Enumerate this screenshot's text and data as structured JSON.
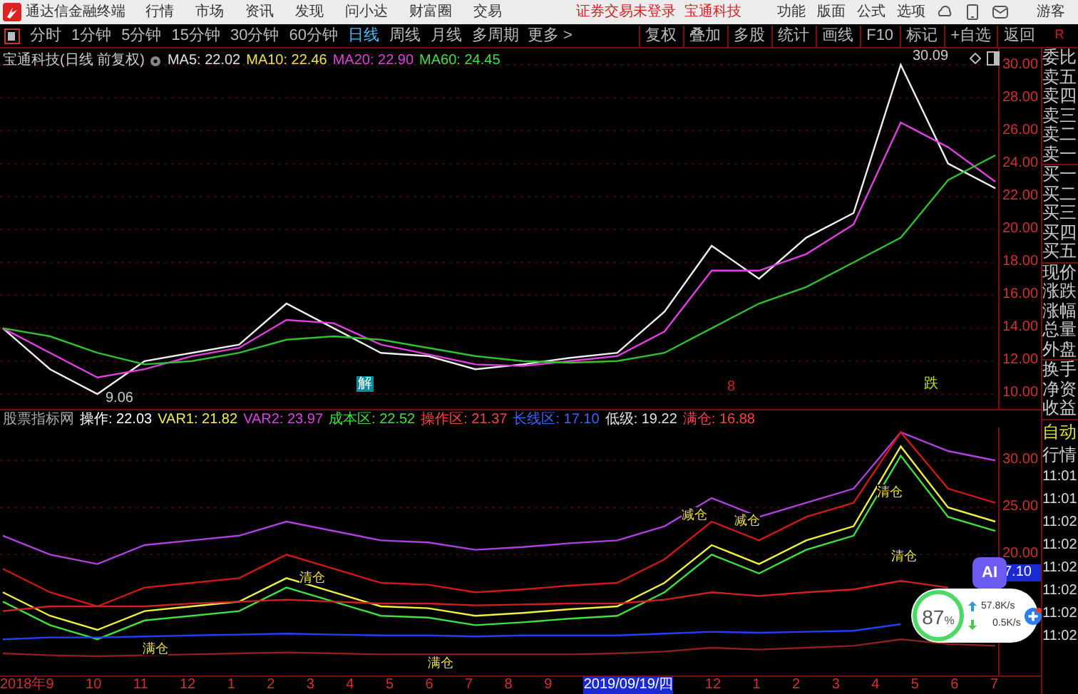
{
  "app": {
    "title": "通达信金融终端",
    "menu": [
      "行情",
      "市场",
      "资讯",
      "发现",
      "问小达",
      "财富圈",
      "交易"
    ],
    "login_status": "证券交易未登录",
    "stock_link": "宝通科技",
    "tools": [
      "功能",
      "版面",
      "公式",
      "选项"
    ],
    "user": "游客"
  },
  "toolbar": {
    "periods": [
      {
        "label": "分时",
        "selected": false
      },
      {
        "label": "1分钟",
        "selected": false
      },
      {
        "label": "5分钟",
        "selected": false
      },
      {
        "label": "15分钟",
        "selected": false
      },
      {
        "label": "30分钟",
        "selected": false
      },
      {
        "label": "60分钟",
        "selected": false
      },
      {
        "label": "日线",
        "selected": true
      },
      {
        "label": "周线",
        "selected": false
      },
      {
        "label": "月线",
        "selected": false
      },
      {
        "label": "多周期",
        "selected": false
      }
    ],
    "more": "更多 >",
    "actions": [
      "复权",
      "叠加",
      "多股",
      "统计",
      "画线",
      "F10",
      "标记",
      "+自选",
      "返回"
    ],
    "corner": "R"
  },
  "main_chart": {
    "title": "宝通科技(日线 前复权)",
    "ma": [
      {
        "label": "MA5: 22.02",
        "color": "#e0e0e0"
      },
      {
        "label": "MA10: 22.46",
        "color": "#f0e040"
      },
      {
        "label": "MA20: 22.90",
        "color": "#e040e0"
      },
      {
        "label": "MA60: 24.45",
        "color": "#40e040"
      }
    ],
    "markers": [
      {
        "kind": "price",
        "text": "30.09"
      },
      {
        "kind": "price",
        "text": "9.06"
      },
      {
        "kind": "tag",
        "text": "解"
      },
      {
        "kind": "signal",
        "text": "8"
      },
      {
        "kind": "event",
        "text": "跌"
      }
    ],
    "chart_data": {
      "type": "line",
      "grid": true,
      "ylim": [
        9,
        31
      ],
      "yticks": [
        {
          "value": 30,
          "label": "30.00"
        },
        {
          "value": 28,
          "label": "28.00"
        },
        {
          "value": 26,
          "label": "26.00"
        },
        {
          "value": 24,
          "label": "24.00"
        },
        {
          "value": 22,
          "label": "22.00"
        },
        {
          "value": 20,
          "label": "20.00"
        },
        {
          "value": 18,
          "label": "18.00"
        },
        {
          "value": 16,
          "label": "16.00"
        },
        {
          "value": 14,
          "label": "14.00"
        },
        {
          "value": 12,
          "label": "12.00"
        },
        {
          "value": 10,
          "label": "10.00"
        }
      ],
      "series": [
        {
          "color": "#f0f0f0",
          "values": [
            14,
            11.5,
            10,
            12,
            12.5,
            13,
            15.5,
            14,
            12.5,
            12.3,
            11.5,
            11.8,
            12.2,
            12.5,
            15,
            19,
            17,
            19.5,
            21,
            30,
            24,
            22.5
          ]
        },
        {
          "color": "#e040e0",
          "values": [
            14,
            12.5,
            11,
            11.5,
            12.3,
            12.8,
            14.5,
            14.3,
            13,
            12.4,
            11.8,
            11.7,
            12,
            12.3,
            13.8,
            17.5,
            17.5,
            18.5,
            20.3,
            26.5,
            25,
            22.9
          ]
        },
        {
          "color": "#30c030",
          "values": [
            14,
            13.5,
            12.5,
            11.8,
            12,
            12.5,
            13.3,
            13.5,
            13.3,
            12.8,
            12.3,
            12,
            11.9,
            12,
            12.5,
            14,
            15.5,
            16.5,
            18,
            19.5,
            23,
            24.5
          ]
        }
      ]
    }
  },
  "indicator": {
    "name": "股票指标网",
    "values": [
      {
        "label": "操作: 22.03",
        "color": "#ffffff"
      },
      {
        "label": "VAR1: 21.82",
        "color": "#f0f040"
      },
      {
        "label": "VAR2: 23.97",
        "color": "#e040e0"
      },
      {
        "label": "成本区: 22.52",
        "color": "#40e040"
      },
      {
        "label": "操作区: 21.37",
        "color": "#ff4040"
      },
      {
        "label": "长线区: 17.10",
        "color": "#4060ff"
      },
      {
        "label": "低级: 19.22",
        "color": "#e0e0e0"
      },
      {
        "label": "满仓: 16.88",
        "color": "#ff4040"
      }
    ],
    "cursor_value": "7.10",
    "signals": [
      "满仓",
      "清仓",
      "满仓",
      "减仓",
      "减仓",
      "清仓",
      "清仓"
    ],
    "chart_data": {
      "type": "line",
      "grid": true,
      "ylim": [
        7,
        33.5
      ],
      "yticks": [
        {
          "value": 30,
          "label": "30.00"
        },
        {
          "value": 25,
          "label": "25.00"
        },
        {
          "value": 20,
          "label": "20.00"
        }
      ],
      "series": [
        {
          "color": "#b040e0",
          "values": [
            22,
            20,
            19,
            21,
            21.5,
            22,
            23.5,
            22.5,
            21.5,
            21.3,
            20.5,
            20.8,
            21.2,
            21.5,
            23,
            26,
            24,
            25.5,
            27,
            33,
            31,
            30
          ]
        },
        {
          "color": "#d01818",
          "values": [
            18.5,
            16,
            14.5,
            16.5,
            17,
            17.5,
            20,
            18.5,
            17,
            16.8,
            16,
            16.3,
            16.7,
            17,
            19.5,
            23.5,
            21.5,
            24,
            25.5,
            33,
            27,
            25.5
          ]
        },
        {
          "color": "#f0f040",
          "values": [
            16,
            13.5,
            12,
            14,
            14.5,
            15,
            17.5,
            16,
            14.5,
            14.3,
            13.5,
            13.8,
            14.2,
            14.5,
            17,
            21,
            19,
            21.5,
            23,
            31.5,
            25,
            23.5
          ]
        },
        {
          "color": "#40e040",
          "values": [
            15,
            12.5,
            11,
            13,
            13.5,
            14,
            16.5,
            15,
            13.5,
            13.3,
            12.5,
            12.8,
            13.2,
            13.5,
            16,
            20,
            18,
            20.5,
            22,
            30.5,
            24,
            22.5
          ]
        },
        {
          "color": "#d02020",
          "values": [
            14,
            14.5,
            14.5,
            14.5,
            14.8,
            15,
            15.2,
            15,
            14.8,
            14.8,
            14.6,
            14.7,
            14.8,
            14.8,
            15.2,
            16,
            15.6,
            16,
            16.3,
            17.2,
            16.5,
            null
          ]
        },
        {
          "color": "#2040ff",
          "values": [
            11,
            11.2,
            11.2,
            11.3,
            11.4,
            11.5,
            11.6,
            11.5,
            11.4,
            11.4,
            11.3,
            11.4,
            11.4,
            11.4,
            11.6,
            11.8,
            11.7,
            11.8,
            11.9,
            12.6,
            null,
            null
          ]
        },
        {
          "color": "#902020",
          "values": [
            9.5,
            9.3,
            9.2,
            9.3,
            9.4,
            9.5,
            9.6,
            9.5,
            9.4,
            9.4,
            9.4,
            9.4,
            9.4,
            9.5,
            9.7,
            10.1,
            9.9,
            10.1,
            10.3,
            11,
            10.5,
            10.3
          ]
        }
      ]
    }
  },
  "date_axis": [
    {
      "label": "2018年9",
      "selected": false
    },
    {
      "label": "10",
      "selected": false
    },
    {
      "label": "11",
      "selected": false
    },
    {
      "label": "12",
      "selected": false
    },
    {
      "label": "1",
      "selected": false
    },
    {
      "label": "2",
      "selected": false
    },
    {
      "label": "3",
      "selected": false
    },
    {
      "label": "4",
      "selected": false
    },
    {
      "label": "5",
      "selected": false
    },
    {
      "label": "6",
      "selected": false
    },
    {
      "label": "7",
      "selected": false
    },
    {
      "label": "8",
      "selected": false
    },
    {
      "label": "9",
      "selected": false
    },
    {
      "label": "2019/09/19/四",
      "selected": true
    },
    {
      "label": "12",
      "selected": false
    },
    {
      "label": "1",
      "selected": false
    },
    {
      "label": "2",
      "selected": false
    },
    {
      "label": "3",
      "selected": false
    },
    {
      "label": "4",
      "selected": false
    },
    {
      "label": "5",
      "selected": false
    },
    {
      "label": "6",
      "selected": false
    },
    {
      "label": "7",
      "selected": false
    }
  ],
  "quote_panel": {
    "labels": [
      "委比",
      "卖五",
      "卖四",
      "卖三",
      "卖二",
      "卖一",
      "买一",
      "买二",
      "买三",
      "买四",
      "买五",
      "现价",
      "涨跌",
      "涨幅",
      "总量",
      "外盘",
      "换手",
      "净资",
      "收益"
    ],
    "tabs": [
      {
        "label": "自动",
        "selected": true
      },
      {
        "label": "行情",
        "selected": false
      }
    ],
    "times": [
      "11:01",
      "11:01",
      "11:02",
      "11:02",
      "11:02",
      "11:02",
      "11:02",
      "11:02"
    ]
  },
  "ai_widget": {
    "button": "AI",
    "percent": "87",
    "unit": "%",
    "upload": "57.8K/s",
    "download": "0.5K/s"
  }
}
